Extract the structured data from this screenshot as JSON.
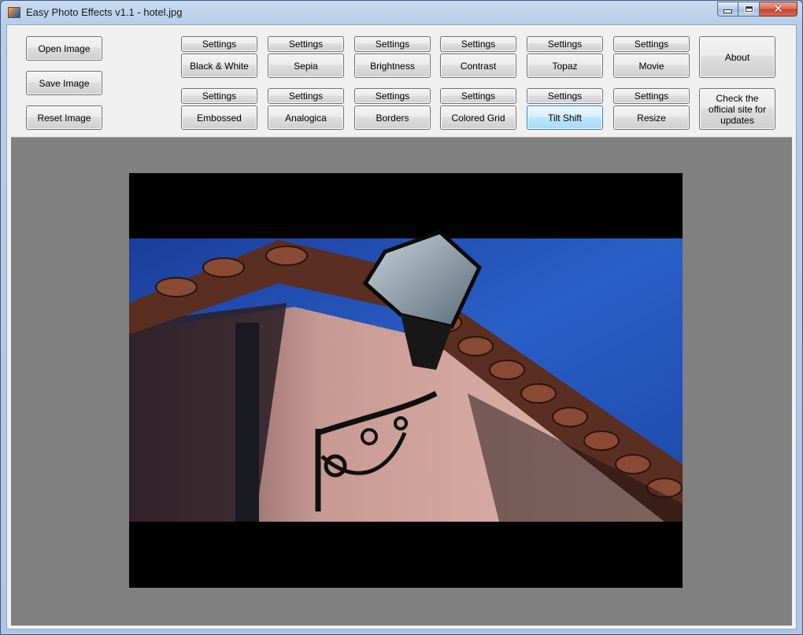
{
  "window": {
    "title": "Easy Photo Effects v1.1 - hotel.jpg",
    "icon": "app-photo-icon"
  },
  "controls": {
    "minimize": "minimize-icon",
    "maximize": "maximize-icon",
    "close": "close-icon",
    "close_glyph": "✕"
  },
  "left_buttons": {
    "open": "Open Image",
    "save": "Save Image",
    "reset": "Reset Image"
  },
  "effects_row1": [
    {
      "settings": "Settings",
      "label": "Black & White"
    },
    {
      "settings": "Settings",
      "label": "Sepia"
    },
    {
      "settings": "Settings",
      "label": "Brightness"
    },
    {
      "settings": "Settings",
      "label": "Contrast"
    },
    {
      "settings": "Settings",
      "label": "Topaz"
    },
    {
      "settings": "Settings",
      "label": "Movie"
    }
  ],
  "effects_row2": [
    {
      "settings": "Settings",
      "label": "Embossed"
    },
    {
      "settings": "Settings",
      "label": "Analogica"
    },
    {
      "settings": "Settings",
      "label": "Borders"
    },
    {
      "settings": "Settings",
      "label": "Colored Grid"
    },
    {
      "settings": "Settings",
      "label": "Tilt Shift"
    },
    {
      "settings": "Settings",
      "label": "Resize"
    }
  ],
  "right_buttons": {
    "about": "About",
    "updates": "Check the official site for updates"
  },
  "hover_button": "Tilt Shift",
  "image": {
    "subject": "wall lantern under tiled roof against blue sky",
    "letterbox": "#000000",
    "canvas_bg": "#808080"
  }
}
